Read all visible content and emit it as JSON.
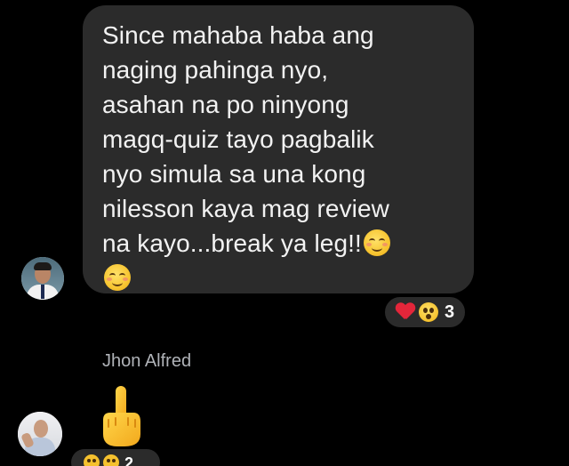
{
  "message": {
    "lines": [
      "Since mahaba haba ang",
      "naging pahinga nyo,",
      "asahan na po ninyong",
      "magq-quiz tayo pagbalik",
      "nyo simula sa una kong",
      "nilesson kaya mag review",
      "na kayo...break ya leg!!"
    ],
    "trailing_emoji": "smiling-face-icon",
    "reactions": {
      "icons": [
        "heart-icon",
        "hushed-face-icon"
      ],
      "count": "3"
    }
  },
  "reply": {
    "sender": "Jhon Alfred",
    "content_emoji": "middle-finger-icon",
    "reactions": {
      "icons": [
        "laughing-face-icon",
        "laughing-face-icon"
      ],
      "count": "2"
    }
  },
  "colors": {
    "background": "#000000",
    "bubble": "#2b2b2b",
    "text": "#f2f2f2",
    "sender_name": "#b0b3b8",
    "heart": "#e3263a",
    "emoji_yellow": "#f5c12e"
  }
}
